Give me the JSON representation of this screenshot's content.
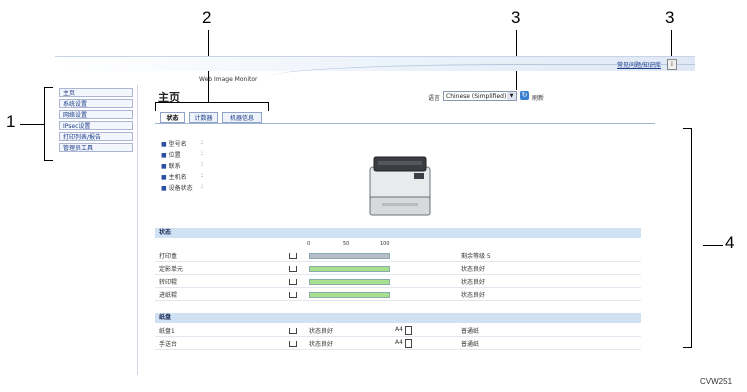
{
  "callouts": {
    "c1": "1",
    "c2": "2",
    "c3a": "3",
    "c3b": "3",
    "c4": "4"
  },
  "figure_code": "CVW251",
  "header": {
    "app_title": "Web Image Monitor",
    "help_link": "常见问题/知识库"
  },
  "sidebar": {
    "items": [
      {
        "label": "主页"
      },
      {
        "label": "系统设置"
      },
      {
        "label": "网络设置"
      },
      {
        "label": "IPsec设置"
      },
      {
        "label": "打印列表/报告"
      },
      {
        "label": "管理员工具"
      }
    ]
  },
  "main": {
    "title": "主页",
    "language_label": "语言",
    "language_value": "Chinese (Simplified)",
    "refresh_label": "刷新",
    "tabs": [
      {
        "label": "状态"
      },
      {
        "label": "计数器"
      },
      {
        "label": "机器信息"
      }
    ],
    "info_rows": [
      {
        "label": "型号名",
        "sep": ":"
      },
      {
        "label": "位置",
        "sep": ":"
      },
      {
        "label": "联系",
        "sep": ":"
      },
      {
        "label": "主机名",
        "sep": ":"
      },
      {
        "label": "设备状态",
        "sep": ":"
      }
    ],
    "status_section": {
      "title": "状态",
      "scale": [
        "0",
        "50",
        "100"
      ],
      "rows": [
        {
          "label": "打印盒",
          "level": 1.0,
          "status": "剩余等级 5",
          "bar_color": "#b8bcc8"
        },
        {
          "label": "定影单元",
          "level": 1.0,
          "status": "状态良好",
          "bar_color": "#a7e08f"
        },
        {
          "label": "转印辊",
          "level": 1.0,
          "status": "状态良好",
          "bar_color": "#a7e08f"
        },
        {
          "label": "进纸辊",
          "level": 1.0,
          "status": "状态良好",
          "bar_color": "#a7e08f"
        }
      ]
    },
    "paper_section": {
      "title": "纸盘",
      "rows": [
        {
          "label": "纸盘1",
          "status": "状态良好",
          "size": "A4",
          "type": "普通纸"
        },
        {
          "label": "手送台",
          "status": "状态良好",
          "size": "A4",
          "type": "普通纸"
        }
      ]
    }
  }
}
